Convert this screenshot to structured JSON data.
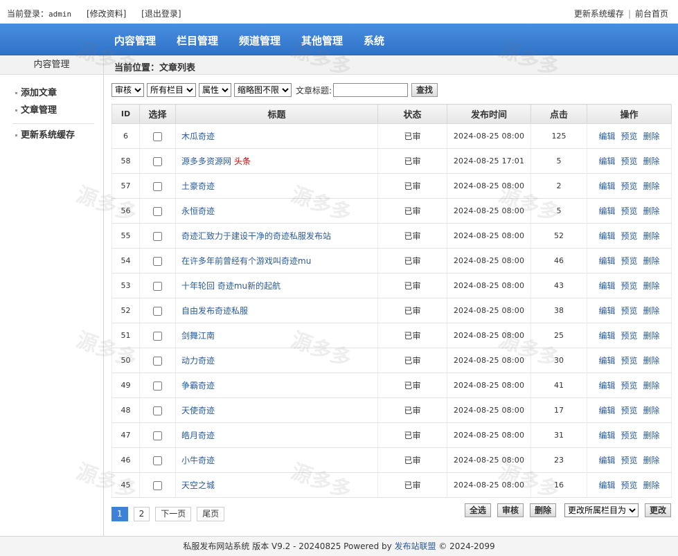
{
  "topbar": {
    "login_label": "当前登录：",
    "username": "admin",
    "edit_profile": "[修改资料]",
    "logout": "[退出登录]",
    "update_cache": "更新系统缓存",
    "separator": "|",
    "front_home": "前台首页"
  },
  "nav": [
    "内容管理",
    "栏目管理",
    "频道管理",
    "其他管理",
    "系统"
  ],
  "sidebar": {
    "header": "内容管理",
    "items": [
      "添加文章",
      "文章管理",
      "更新系统缓存"
    ]
  },
  "breadcrumb": "当前位置：文章列表",
  "filters": {
    "status_select": "审核",
    "category_select": "所有栏目",
    "attr_select": "属性",
    "thumb_select": "缩略图不限",
    "title_label": "文章标题:",
    "title_value": "",
    "search_button": "查找"
  },
  "table": {
    "headers": [
      "ID",
      "选择",
      "标题",
      "状态",
      "发布时间",
      "点击",
      "操作"
    ],
    "ops": [
      "编辑",
      "预览",
      "删除"
    ],
    "rows": [
      {
        "id": "6",
        "title": "木瓜奇迹",
        "tag": "",
        "status": "已审",
        "time": "2024-08-25 08:00",
        "hits": "125"
      },
      {
        "id": "58",
        "title": "源多多资源网",
        "tag": "头条",
        "status": "已审",
        "time": "2024-08-25 17:01",
        "hits": "5"
      },
      {
        "id": "57",
        "title": "土豪奇迹",
        "tag": "",
        "status": "已审",
        "time": "2024-08-25 08:00",
        "hits": "2"
      },
      {
        "id": "56",
        "title": "永恒奇迹",
        "tag": "",
        "status": "已审",
        "time": "2024-08-25 08:00",
        "hits": "5"
      },
      {
        "id": "55",
        "title": "奇迹汇致力于建设干净的奇迹私服发布站",
        "tag": "",
        "status": "已审",
        "time": "2024-08-25 08:00",
        "hits": "52"
      },
      {
        "id": "54",
        "title": "在许多年前曾经有个游戏叫奇迹mu",
        "tag": "",
        "status": "已审",
        "time": "2024-08-25 08:00",
        "hits": "46"
      },
      {
        "id": "53",
        "title": "十年轮回 奇迹mu新的起航",
        "tag": "",
        "status": "已审",
        "time": "2024-08-25 08:00",
        "hits": "43"
      },
      {
        "id": "52",
        "title": "自由发布奇迹私服",
        "tag": "",
        "status": "已审",
        "time": "2024-08-25 08:00",
        "hits": "38"
      },
      {
        "id": "51",
        "title": "剑舞江南",
        "tag": "",
        "status": "已审",
        "time": "2024-08-25 08:00",
        "hits": "25"
      },
      {
        "id": "50",
        "title": "动力奇迹",
        "tag": "",
        "status": "已审",
        "time": "2024-08-25 08:00",
        "hits": "30"
      },
      {
        "id": "49",
        "title": "争霸奇迹",
        "tag": "",
        "status": "已审",
        "time": "2024-08-25 08:00",
        "hits": "41"
      },
      {
        "id": "48",
        "title": "天使奇迹",
        "tag": "",
        "status": "已审",
        "time": "2024-08-25 08:00",
        "hits": "17"
      },
      {
        "id": "47",
        "title": "皓月奇迹",
        "tag": "",
        "status": "已审",
        "time": "2024-08-25 08:00",
        "hits": "31"
      },
      {
        "id": "46",
        "title": "小牛奇迹",
        "tag": "",
        "status": "已审",
        "time": "2024-08-25 08:00",
        "hits": "23"
      },
      {
        "id": "45",
        "title": "天空之城",
        "tag": "",
        "status": "已审",
        "time": "2024-08-25 08:00",
        "hits": "16"
      }
    ]
  },
  "pager": [
    "1",
    "2",
    "下一页",
    "尾页"
  ],
  "actions": {
    "select_all": "全选",
    "approve": "审核",
    "delete": "删除",
    "move_select": "更改所属栏目为",
    "change": "更改"
  },
  "footer": {
    "text": "私服发布网站系统 版本 V9.2 - 20240825 Powered by ",
    "link": "发布站联盟",
    "copyright": " © 2024-2099"
  },
  "watermark": "源多多"
}
